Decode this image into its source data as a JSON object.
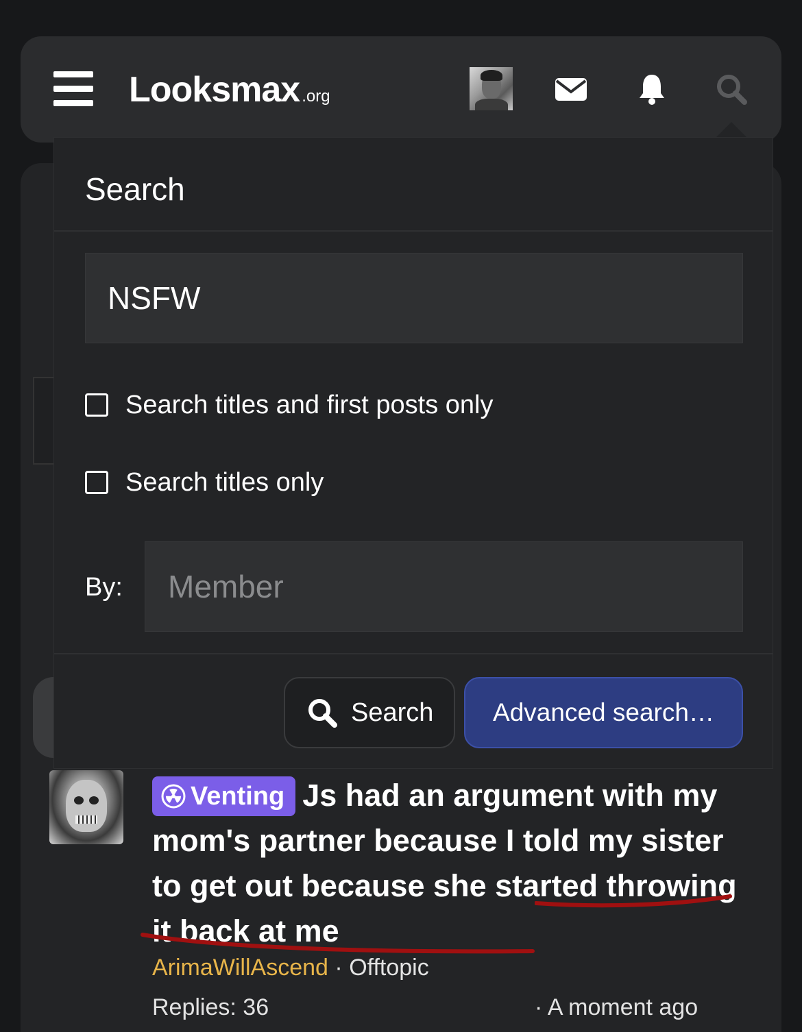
{
  "header": {
    "logo_main": "Looksmax",
    "logo_tld": ".org"
  },
  "search_dropdown": {
    "title": "Search",
    "query_value": "NSFW",
    "option_titles_first_posts": "Search titles and first posts only",
    "option_titles_only": "Search titles only",
    "by_label": "By:",
    "member_placeholder": "Member",
    "search_button_label": "Search",
    "advanced_button_label": "Advanced search…"
  },
  "thread": {
    "prefix_label": "Venting",
    "title": "Js had an argument with my mom's partner because I told my sister to get out because she started throwing it back at me",
    "author": "ArimaWillAscend",
    "separator": "·",
    "forum": "Offtopic",
    "replies": "Replies: 36",
    "time": "· A moment ago"
  },
  "colors": {
    "background": "#17181a",
    "panel": "#232426",
    "header": "#2b2c2e",
    "input": "#2f3032",
    "accent_button": "#2d3d82",
    "prefix_venting": "#7b5ee8",
    "author_color": "#e8b54a",
    "annotation_underline": "#a01010"
  }
}
